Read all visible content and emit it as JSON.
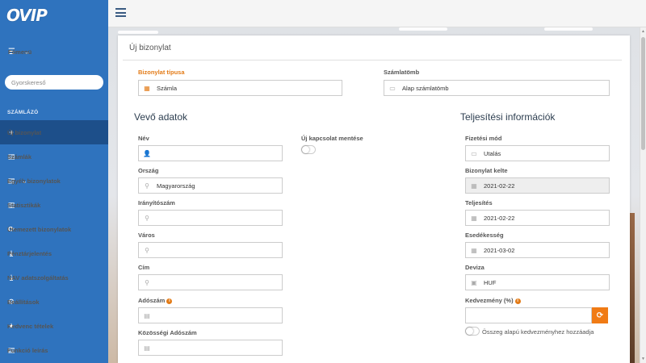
{
  "app": {
    "logo": "OVIP"
  },
  "sidebar": {
    "menu_label": "Főmenü",
    "search_placeholder": "Gyorskereső",
    "section_label": "SZÁMLÁZÓ",
    "items": [
      {
        "label": "Új bizonylat",
        "icon": "plus-icon"
      },
      {
        "label": "Számlák",
        "icon": "document-icon"
      },
      {
        "label": "Egyéb bizonylatok",
        "icon": "document-icon"
      },
      {
        "label": "Statisztikák",
        "icon": "bar-chart-icon"
      },
      {
        "label": "Ütemezett bizonylatok",
        "icon": "refresh-icon"
      },
      {
        "label": "Pénztárjelentés",
        "icon": "download-icon"
      },
      {
        "label": "NAV adatszolgáltatás",
        "icon": "download-icon"
      },
      {
        "label": "Beállítások",
        "icon": "gear-icon"
      },
      {
        "label": "Kedvenc tételek",
        "icon": "star-icon"
      },
      {
        "label": "Funkció leírás",
        "icon": "book-icon"
      }
    ]
  },
  "panel": {
    "title": "Új bizonylat",
    "doc_type": {
      "label": "Bizonylat típusa",
      "value": "Számla"
    },
    "block": {
      "label": "Számlatömb",
      "value": "Alap számlatömb"
    },
    "buyer": {
      "heading": "Vevő adatok",
      "name": {
        "label": "Név",
        "value": ""
      },
      "country": {
        "label": "Ország",
        "value": "Magyarország"
      },
      "zip": {
        "label": "Irányítószám",
        "value": ""
      },
      "city": {
        "label": "Város",
        "value": ""
      },
      "address": {
        "label": "Cím",
        "value": ""
      },
      "tax": {
        "label": "Adószám",
        "value": ""
      },
      "eu_tax": {
        "label": "Közösségi Adószám",
        "value": ""
      },
      "save_contact": {
        "label": "Új kapcsolat mentése"
      }
    },
    "fulfillment": {
      "heading": "Teljesítési információk",
      "payment": {
        "label": "Fizetési mód",
        "value": "Utalás"
      },
      "issue_date": {
        "label": "Bizonylat kelte",
        "value": "2021-02-22"
      },
      "fulfill_date": {
        "label": "Teljesítés",
        "value": "2021-02-22"
      },
      "due_date": {
        "label": "Esedékesség",
        "value": "2021-03-02"
      },
      "currency": {
        "label": "Deviza",
        "value": "HUF"
      },
      "discount": {
        "label": "Kedvezmény (%)",
        "value": ""
      },
      "amount_discount_toggle": "Összeg alapú kedvezményhez hozzáadja"
    }
  },
  "colors": {
    "sidebar": "#2f73be",
    "sidebar_active": "#1d4f8a",
    "accent": "#e37b17",
    "button": "#f07b15"
  }
}
